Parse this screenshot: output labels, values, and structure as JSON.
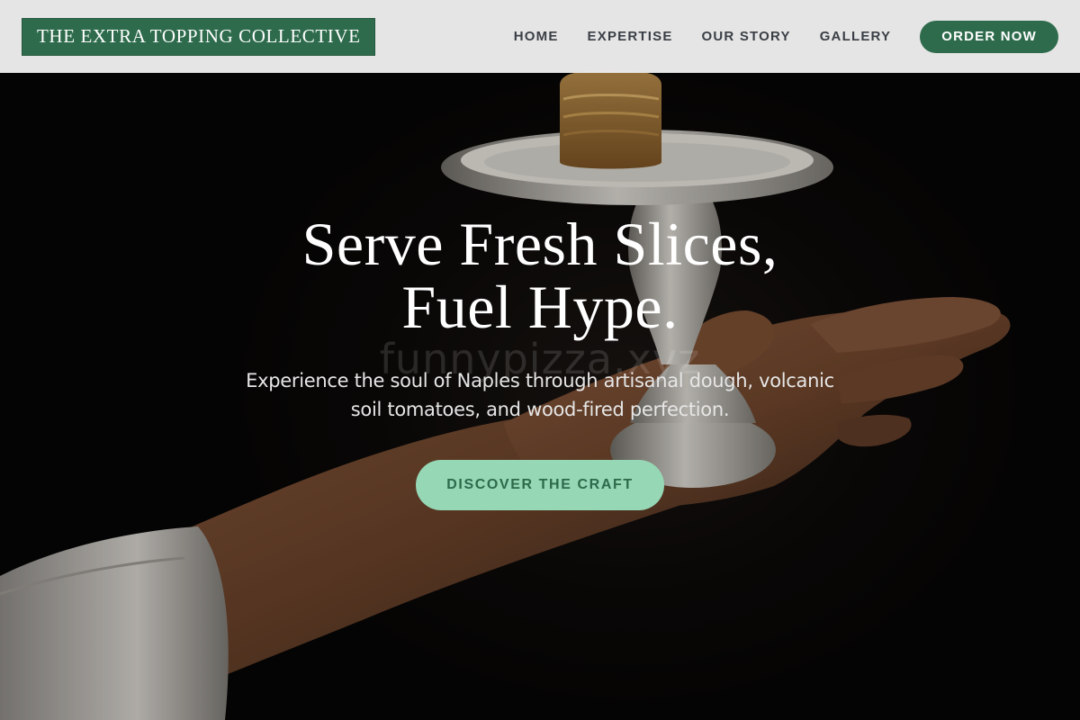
{
  "brand": {
    "name": "THE EXTRA TOPPING COLLECTIVE"
  },
  "nav": {
    "items": [
      {
        "label": "HOME"
      },
      {
        "label": "EXPERTISE"
      },
      {
        "label": "OUR STORY"
      },
      {
        "label": "GALLERY"
      }
    ],
    "order_label": "ORDER NOW"
  },
  "hero": {
    "title_line1": "Serve Fresh Slices,",
    "title_line2": "Fuel Hype.",
    "subtitle": "Experience the soul of Naples through artisanal dough, volcanic soil tomatoes, and wood-fired perfection.",
    "cta_label": "DISCOVER THE CRAFT",
    "watermark": "funnypizza.xyz"
  },
  "colors": {
    "brand_green": "#2e6b4c",
    "cta_mint": "#96d7b5",
    "header_bg": "#ececec",
    "nav_text": "#3a3f46"
  }
}
